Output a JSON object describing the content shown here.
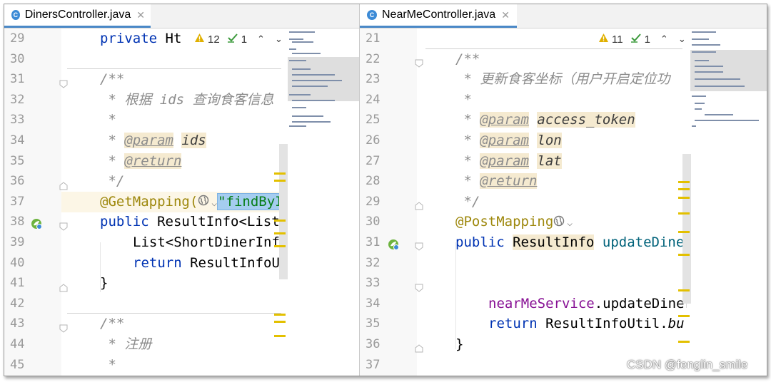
{
  "left": {
    "tab_label": "DinersController.java",
    "warnings": "12",
    "checks": "1",
    "lines": [
      {
        "n": "29"
      },
      {
        "n": "30"
      },
      {
        "n": "31"
      },
      {
        "n": "32"
      },
      {
        "n": "33"
      },
      {
        "n": "34"
      },
      {
        "n": "35"
      },
      {
        "n": "36"
      },
      {
        "n": "37"
      },
      {
        "n": "38"
      },
      {
        "n": "39"
      },
      {
        "n": "40"
      },
      {
        "n": "41"
      },
      {
        "n": "42"
      },
      {
        "n": "43"
      },
      {
        "n": "44"
      },
      {
        "n": "45"
      }
    ],
    "code": {
      "l29_kw": "private",
      "l29_rest": " Ht",
      "l31": "/**",
      "l32": " * 根据 ids 查询食客信息",
      "l33": " *",
      "l34_pre": " * ",
      "l34_tag": "@param",
      "l34_val": "ids",
      "l35_pre": " * ",
      "l35_tag": "@return",
      "l36": " */",
      "l37_ann": "@GetMapping(",
      "l37_str": "\"findByI",
      "l38_kw": "public",
      "l38_rest": " ResultInfo<List<",
      "l39": "List<ShortDinerInfo",
      "l40_kw": "return",
      "l40_rest": " ResultInfoUti",
      "l41": "}",
      "l43": "/**",
      "l44": " * 注册",
      "l45": " *"
    }
  },
  "right": {
    "tab_label": "NearMeController.java",
    "warnings": "11",
    "checks": "1",
    "lines": [
      {
        "n": "21"
      },
      {
        "n": "22"
      },
      {
        "n": "23"
      },
      {
        "n": "24"
      },
      {
        "n": "25"
      },
      {
        "n": "26"
      },
      {
        "n": "27"
      },
      {
        "n": "28"
      },
      {
        "n": "29"
      },
      {
        "n": "30"
      },
      {
        "n": "31"
      },
      {
        "n": "32"
      },
      {
        "n": "33"
      },
      {
        "n": "34"
      },
      {
        "n": "35"
      },
      {
        "n": "36"
      },
      {
        "n": "37"
      }
    ],
    "code": {
      "l22": "/**",
      "l23": " * 更新食客坐标（用户开启定位功",
      "l24": " *",
      "l25_pre": " * ",
      "l25_tag": "@param",
      "l25_val": "access_token",
      "l26_pre": " * ",
      "l26_tag": "@param",
      "l26_val": "lon",
      "l27_pre": " * ",
      "l27_tag": "@param",
      "l27_val": "lat",
      "l28_pre": " * ",
      "l28_tag": "@return",
      "l29": " */",
      "l30_ann": "@PostMapping",
      "l31_kw": "public",
      "l31_type": "ResultInfo",
      "l31_mth": " updateDiner",
      "l34_fld": "nearMeService",
      "l34_rest": ".updateDiner",
      "l35_kw": "return",
      "l35_rest": " ResultInfoUtil.",
      "l35_it": "bu",
      "l36": "}"
    }
  },
  "watermark": "CSDN @fenglin_smile",
  "icons": [
    "java-class-icon",
    "close-icon",
    "warning-icon",
    "check-icon",
    "arrow-up-icon",
    "arrow-down-icon",
    "globe-icon",
    "chevron-down-icon",
    "spring-bean-icon",
    "fold-icon"
  ]
}
